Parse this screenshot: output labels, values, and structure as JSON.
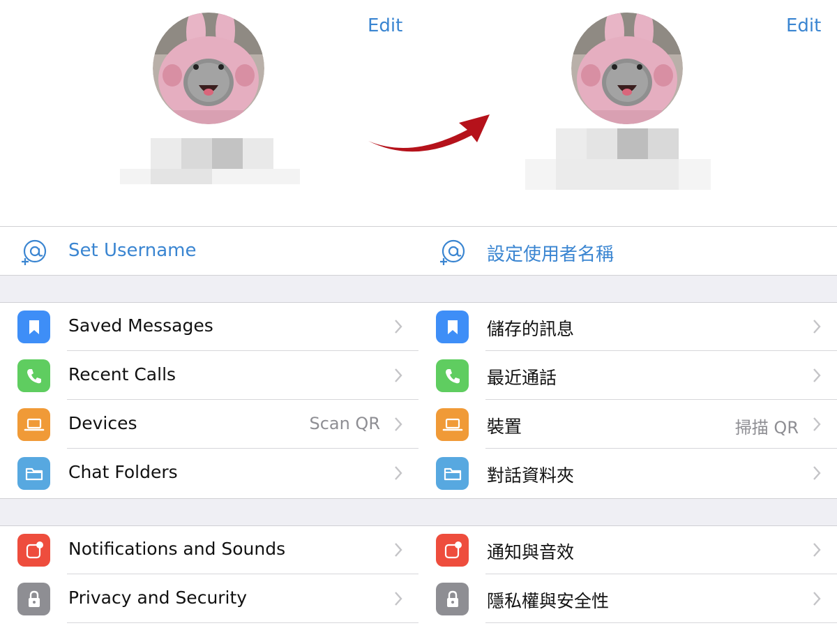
{
  "left": {
    "edit_label": "Edit",
    "username_label": "Set Username",
    "group1": [
      {
        "label": "Saved Messages",
        "value": "",
        "icon": "bookmark-icon",
        "color": "#3e8ef7"
      },
      {
        "label": "Recent Calls",
        "value": "",
        "icon": "phone-icon",
        "color": "#5fcd60"
      },
      {
        "label": "Devices",
        "value": "Scan QR",
        "icon": "laptop-icon",
        "color": "#f09a37"
      },
      {
        "label": "Chat Folders",
        "value": "",
        "icon": "folder-icon",
        "color": "#57a8e0"
      }
    ],
    "group2": [
      {
        "label": "Notifications and Sounds",
        "value": "",
        "icon": "notification-icon",
        "color": "#ee4d3d"
      },
      {
        "label": "Privacy and Security",
        "value": "",
        "icon": "lock-icon",
        "color": "#8e8e93"
      }
    ]
  },
  "right": {
    "edit_label": "Edit",
    "username_label": "設定使用者名稱",
    "group1": [
      {
        "label": "儲存的訊息",
        "value": "",
        "icon": "bookmark-icon",
        "color": "#3e8ef7"
      },
      {
        "label": "最近通話",
        "value": "",
        "icon": "phone-icon",
        "color": "#5fcd60"
      },
      {
        "label": "裝置",
        "value": "掃描 QR",
        "icon": "laptop-icon",
        "color": "#f09a37"
      },
      {
        "label": "對話資料夾",
        "value": "",
        "icon": "folder-icon",
        "color": "#57a8e0"
      }
    ],
    "group2": [
      {
        "label": "通知與音效",
        "value": "",
        "icon": "notification-icon",
        "color": "#ee4d3d"
      },
      {
        "label": "隱私權與安全性",
        "value": "",
        "icon": "lock-icon",
        "color": "#8e8e93"
      }
    ]
  },
  "colors": {
    "accent": "#3a85d1",
    "arrow": "#b5121b",
    "background": "#ffffff",
    "section_gap": "#efeff4"
  }
}
